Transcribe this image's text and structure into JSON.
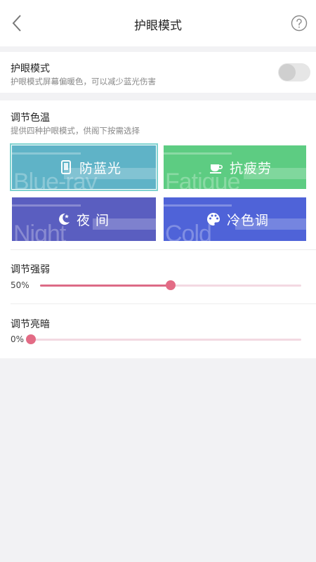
{
  "header": {
    "title": "护眼模式",
    "back_icon": "chevron-left-icon",
    "help_icon": "question-circle-icon"
  },
  "eye_mode": {
    "title": "护眼模式",
    "subtitle": "护眼模式屏幕偏暖色，可以减少蓝光伤害",
    "enabled": false
  },
  "color_temp": {
    "title": "调节色温",
    "subtitle": "提供四种护眼模式，供阁下按需选择",
    "modes": [
      {
        "label": "防蓝光",
        "en": "Blue-ray",
        "icon": "phone-icon",
        "color": "#5fb3c7",
        "selected": true
      },
      {
        "label": "抗疲劳",
        "en": "Fatigue",
        "icon": "coffee-cup-icon",
        "color": "#5dcc82",
        "selected": false
      },
      {
        "label": "夜 间",
        "en": "Night",
        "icon": "moon-star-icon",
        "color": "#5a5ec0",
        "selected": false
      },
      {
        "label": "冷色调",
        "en": "Cold",
        "icon": "palette-icon",
        "color": "#4f63d8",
        "selected": false
      }
    ]
  },
  "strength": {
    "title": "调节强弱",
    "value_label": "50%",
    "value": 0.5
  },
  "brightness": {
    "title": "调节亮暗",
    "value_label": "0%",
    "value": 0.0
  },
  "colors": {
    "accent": "#e36b85",
    "track": "#f3d9e2"
  }
}
